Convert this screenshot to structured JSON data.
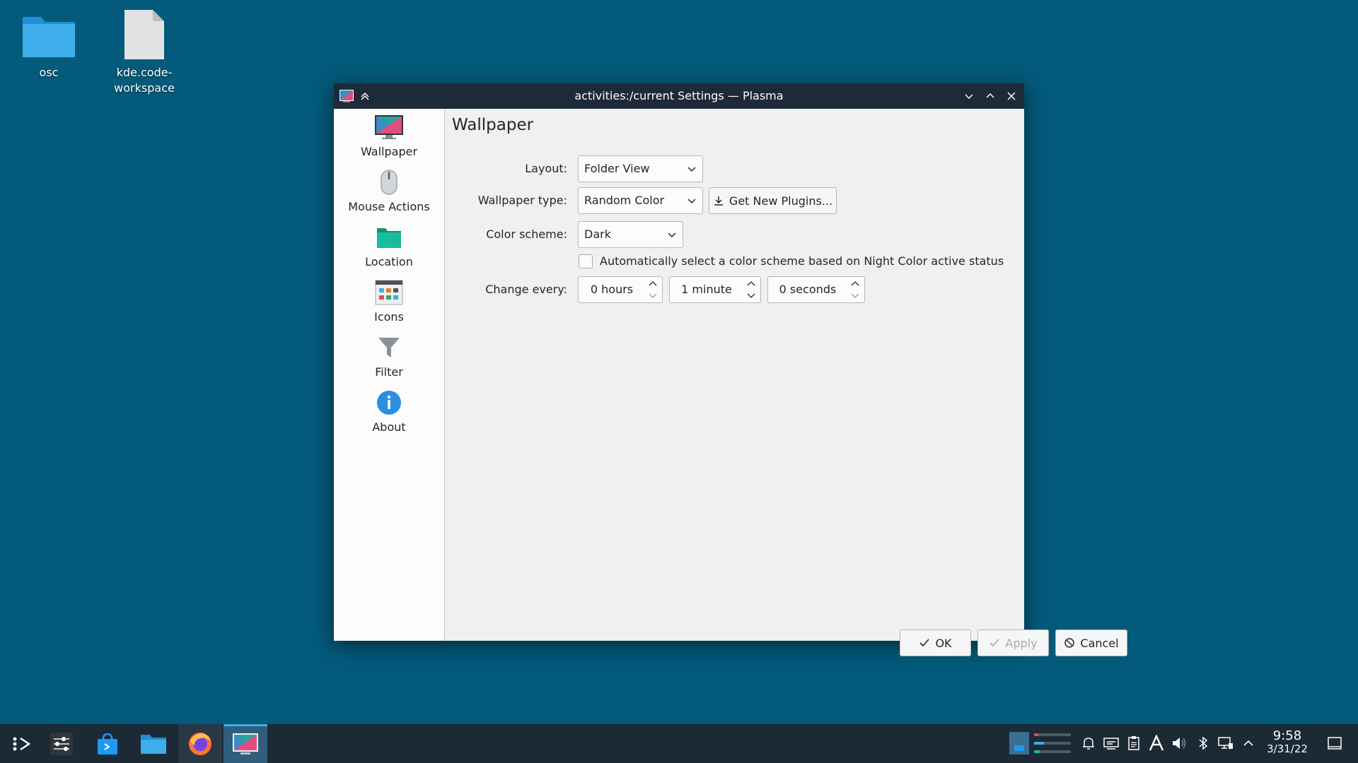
{
  "desktop": {
    "icons": [
      {
        "label": "osc",
        "icon": "folder-icon"
      },
      {
        "label": "kde.code-workspace",
        "icon": "file-icon"
      }
    ]
  },
  "window": {
    "title": "activities:/current Settings — Plasma",
    "sidebar": {
      "items": [
        {
          "label": "Wallpaper",
          "icon": "wallpaper-icon"
        },
        {
          "label": "Mouse Actions",
          "icon": "mouse-icon"
        },
        {
          "label": "Location",
          "icon": "folder-location-icon"
        },
        {
          "label": "Icons",
          "icon": "icons-icon"
        },
        {
          "label": "Filter",
          "icon": "filter-icon"
        },
        {
          "label": "About",
          "icon": "info-icon"
        }
      ]
    },
    "content": {
      "title": "Wallpaper",
      "layout": {
        "label": "Layout:",
        "value": "Folder View"
      },
      "wallpaper_type": {
        "label": "Wallpaper type:",
        "value": "Random Color"
      },
      "get_plugins_label": "Get New Plugins...",
      "color_scheme": {
        "label": "Color scheme:",
        "value": "Dark"
      },
      "auto_checkbox": {
        "label": "Automatically select a color scheme based on Night Color active status",
        "checked": false
      },
      "change_every": {
        "label": "Change every:",
        "hours": "0 hours",
        "minutes": "1 minute",
        "seconds": "0 seconds"
      }
    },
    "buttons": {
      "ok": "OK",
      "apply": "Apply",
      "cancel": "Cancel"
    }
  },
  "taskbar": {
    "clock": {
      "time": "9:58",
      "date": "3/31/22"
    },
    "accent_color": "#3daee9"
  }
}
